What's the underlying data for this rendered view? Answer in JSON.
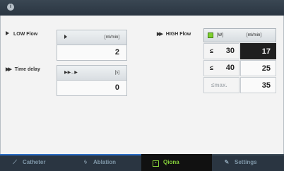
{
  "topbar": {
    "info_icon": "info-icon",
    "title": "",
    "right_1": "",
    "right_2": ""
  },
  "left": {
    "low_flow": {
      "label": "LOW Flow",
      "icon": "play-icon",
      "unit": "[ml/min]",
      "value": "2"
    },
    "time_delay": {
      "label": "Time delay",
      "icon": "fast-forward-icon",
      "unit": "[s]",
      "value": "0"
    }
  },
  "high_flow": {
    "label": "HIGH Flow",
    "header": {
      "col1": "[W]",
      "col2": "[ml/min]"
    },
    "rows": [
      {
        "symbol": "≤",
        "power": "30",
        "flow": "17",
        "active": true
      },
      {
        "symbol": "≤",
        "power": "40",
        "flow": "25",
        "active": false
      },
      {
        "symbol": "≤",
        "power": "max.",
        "flow": "35",
        "active": false,
        "disabled": true
      }
    ]
  },
  "nav": {
    "tabs": [
      {
        "label": "Catheter",
        "icon": "catheter-icon"
      },
      {
        "label": "Ablation",
        "icon": "ablation-icon"
      },
      {
        "label": "Qiona",
        "icon": "qiona-icon",
        "active": true
      },
      {
        "label": "Settings",
        "icon": "wrench-icon"
      }
    ],
    "colors": {
      "accent_blue": "#2b6cc3",
      "accent_green": "#78c93a",
      "bg": "#2a3541"
    }
  }
}
